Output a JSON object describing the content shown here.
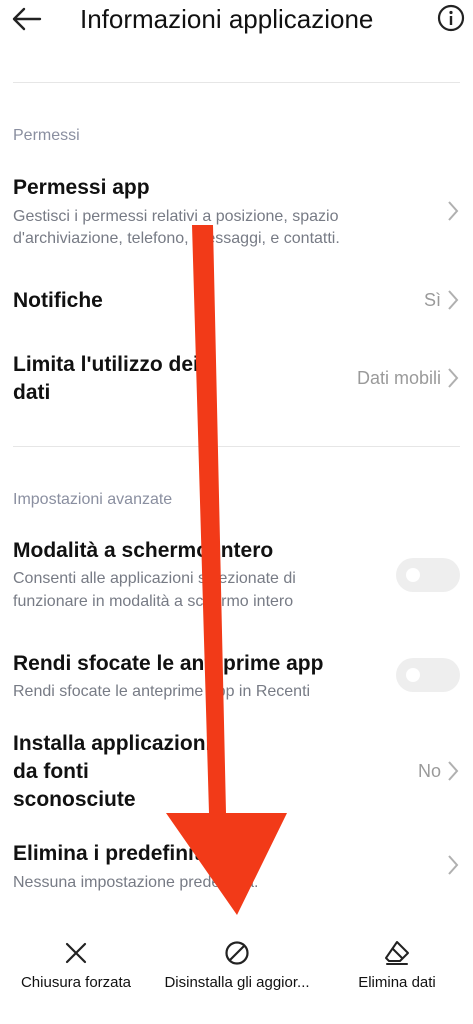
{
  "header": {
    "title": "Informazioni applicazione",
    "back_icon": "back-arrow-icon",
    "info_icon": "info-icon"
  },
  "sections": {
    "permissions_label": "Permessi",
    "advanced_label": "Impostazioni avanzate"
  },
  "rows": {
    "permessi_app": {
      "title": "Permessi app",
      "subtitle": "Gestisci i permessi relativi a posizione, spazio d'archiviazione, telefono, messaggi, e contatti."
    },
    "notifiche": {
      "title": "Notifiche",
      "value": "Sì"
    },
    "limita_dati": {
      "title_line1": "Limita l'utilizzo dei",
      "title_line2": "dati",
      "value": "Dati mobili"
    },
    "schermo_intero": {
      "title": "Modalità a schermo intero",
      "subtitle_line1": "Consenti alle applicazioni selezionate di",
      "subtitle_line2": "funzionare in modalità a schermo intero",
      "enabled": false
    },
    "sfocate": {
      "title": "Rendi sfocate le anteprime app",
      "subtitle": "Rendi sfocate le anteprime app in Recenti",
      "enabled": false
    },
    "fonti_sconosciute": {
      "title_line1": "Installa applicazioni",
      "title_line2": "da fonti",
      "title_line3": "sconosciute",
      "value": "No"
    },
    "predefiniti": {
      "title": "Elimina i predefiniti",
      "subtitle": "Nessuna impostazione predefinita."
    }
  },
  "bottom_bar": {
    "force_stop": {
      "label": "Chiusura forzata",
      "icon": "close-icon"
    },
    "uninstall_updates": {
      "label": "Disinstalla gli aggior...",
      "icon": "block-icon"
    },
    "clear_data": {
      "label": "Elimina dati",
      "icon": "eraser-icon"
    }
  },
  "colors": {
    "annotation_arrow": "#f23a18",
    "section_label": "#8a8fa0",
    "toggle_off": "#eeeeee"
  }
}
